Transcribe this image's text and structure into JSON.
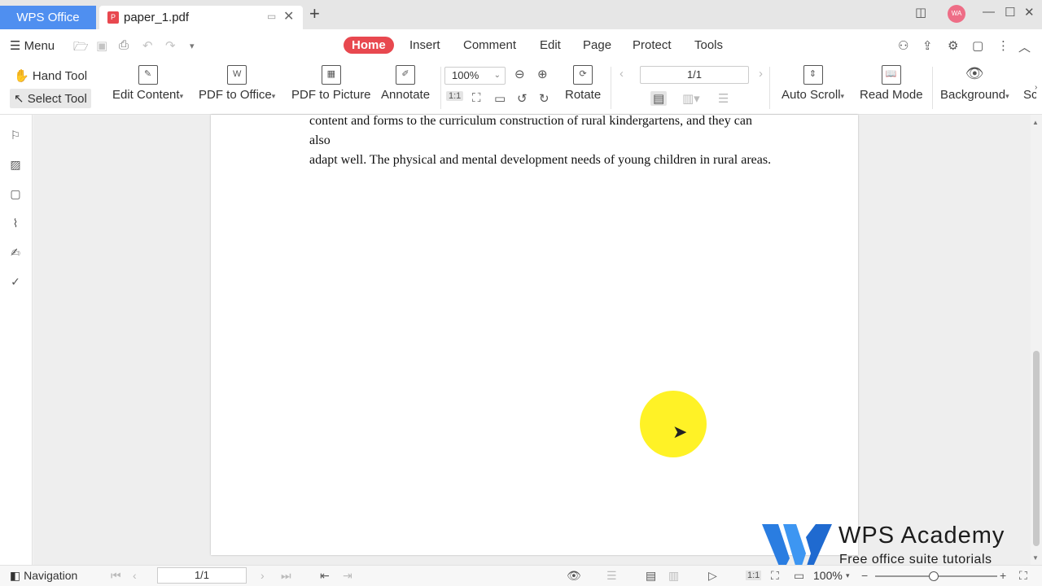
{
  "titlebar": {
    "app_tab": "WPS Office",
    "doc_tab": "paper_1.pdf",
    "avatar": "WA"
  },
  "menubar": {
    "menu_label": "Menu",
    "tabs": [
      "Home",
      "Insert",
      "Comment",
      "Edit",
      "Page",
      "Protect",
      "Tools"
    ],
    "active_tab": "Home"
  },
  "toolbar": {
    "hand_tool": "Hand Tool",
    "select_tool": "Select Tool",
    "edit_content": "Edit Content",
    "pdf_to_office": "PDF to Office",
    "pdf_to_picture": "PDF to Picture",
    "annotate": "Annotate",
    "zoom": "100%",
    "rotate": "Rotate",
    "page_indicator": "1/1",
    "auto_scroll": "Auto Scroll",
    "read_mode": "Read Mode",
    "background": "Background",
    "cut_off": "Sc"
  },
  "document": {
    "line1": "content and forms to the curriculum construction of rural kindergartens, and they can also",
    "line2": "adapt well. The physical and mental development needs of young children in rural areas."
  },
  "watermark": {
    "title": "WPS Academy",
    "subtitle": "Free office suite tutorials"
  },
  "statusbar": {
    "navigation": "Navigation",
    "page": "1/1",
    "zoom": "100%"
  },
  "colors": {
    "accent_red": "#e8484f",
    "app_blue": "#4f8ff0",
    "cursor_highlight": "#fff000"
  }
}
